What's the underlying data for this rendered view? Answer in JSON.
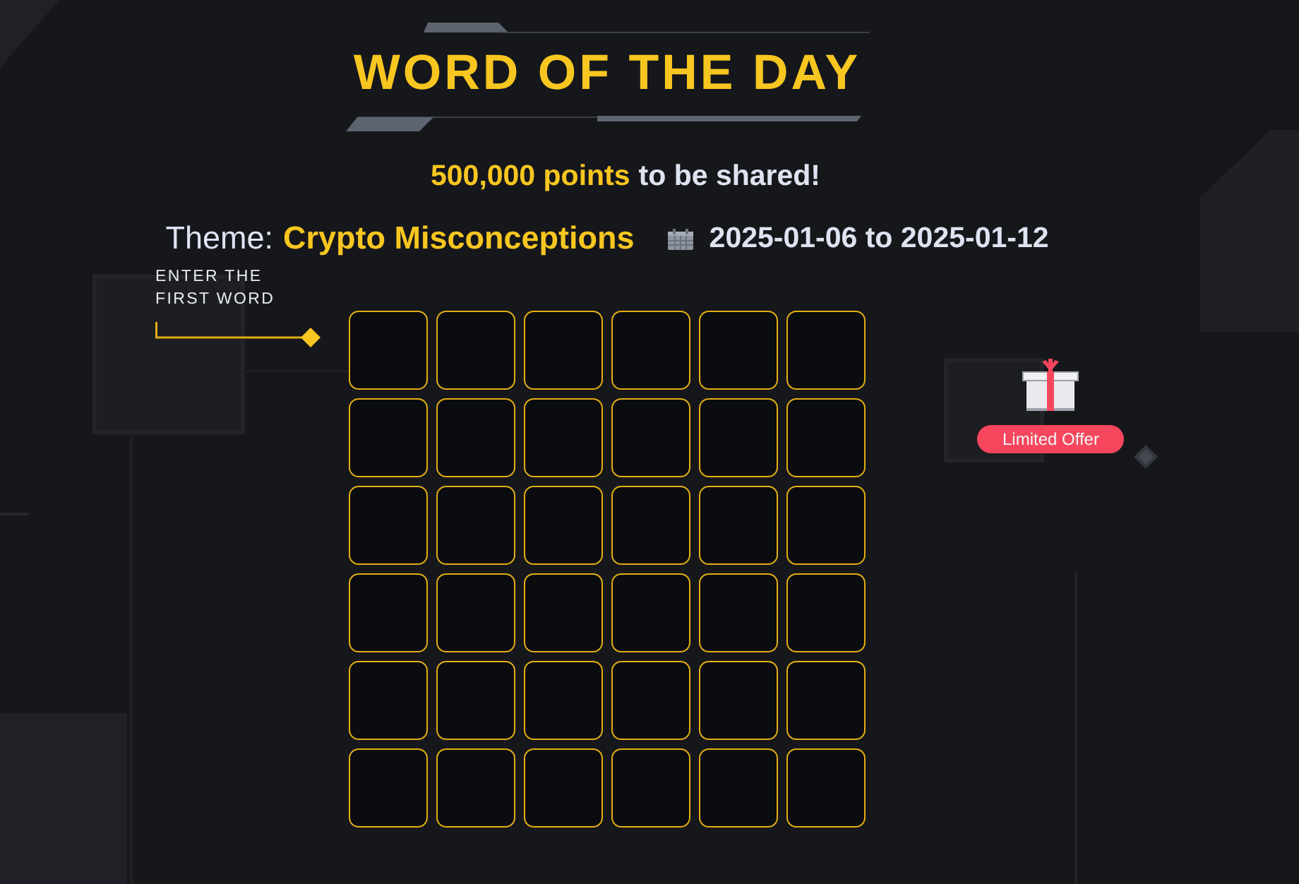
{
  "header": {
    "title": "WORD OF THE DAY",
    "prize_amount": "500,000 points",
    "prize_caption": "to be shared!"
  },
  "theme": {
    "label": "Theme:",
    "value": "Crypto Misconceptions",
    "date_range": "2025-01-06 to 2025-01-12"
  },
  "prompt": "ENTER THE FIRST WORD",
  "board": {
    "rows": [
      {
        "cells": [
          {
            "filled": false
          },
          {
            "filled": false
          },
          {
            "filled": false
          },
          {
            "filled": false
          },
          {
            "filled": false
          },
          {
            "filled": false
          }
        ]
      },
      {
        "cells": [
          {
            "filled": false
          },
          {
            "filled": false
          },
          {
            "filled": false
          },
          {
            "filled": false
          },
          {
            "filled": false
          },
          {
            "filled": false
          }
        ]
      },
      {
        "cells": [
          {
            "filled": false
          },
          {
            "filled": false
          },
          {
            "filled": false
          },
          {
            "filled": false
          },
          {
            "filled": false
          },
          {
            "filled": false
          }
        ]
      },
      {
        "cells": [
          {
            "filled": false
          },
          {
            "filled": false
          },
          {
            "filled": false
          },
          {
            "filled": false
          },
          {
            "filled": false
          },
          {
            "filled": false
          }
        ]
      },
      {
        "cells": [
          {
            "filled": false
          },
          {
            "filled": false
          },
          {
            "filled": false
          },
          {
            "filled": false
          },
          {
            "filled": false
          },
          {
            "filled": false
          }
        ]
      },
      {
        "cells": [
          {
            "filled": false
          },
          {
            "filled": false
          },
          {
            "filled": false
          },
          {
            "filled": false
          },
          {
            "filled": false
          },
          {
            "filled": false
          }
        ]
      }
    ]
  },
  "offer": {
    "badge": "Limited Offer"
  }
}
